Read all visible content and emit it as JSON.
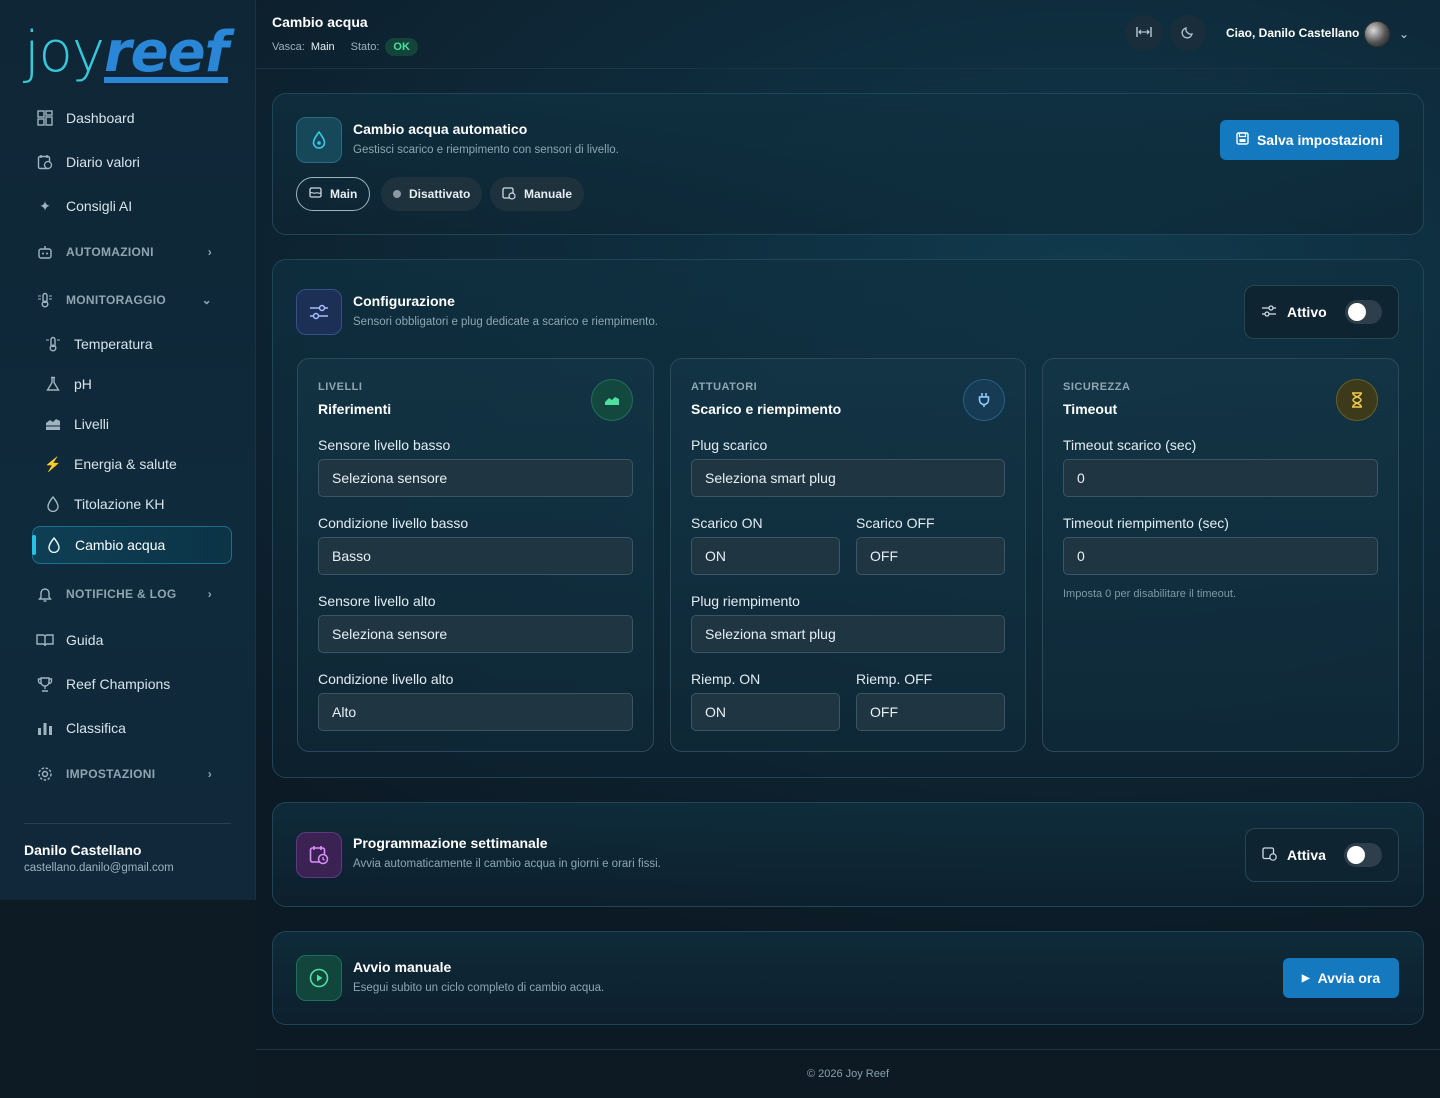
{
  "brand": {
    "joy": "joy",
    "reef": "reef"
  },
  "sidebar": {
    "items": [
      {
        "label": "Dashboard",
        "icon": "dashboard-icon"
      },
      {
        "label": "Diario valori",
        "icon": "calendar-journal-icon"
      },
      {
        "label": "Consigli AI",
        "icon": "sparkles-icon"
      }
    ],
    "automazioni": "AUTOMAZIONI",
    "monitoraggio": "MONITORAGGIO",
    "sub": [
      {
        "label": "Temperatura",
        "icon": "thermometer-icon"
      },
      {
        "label": "pH",
        "icon": "flask-icon"
      },
      {
        "label": "Livelli",
        "icon": "waves-icon"
      },
      {
        "label": "Energia & salute",
        "icon": "bolt-icon"
      },
      {
        "label": "Titolazione KH",
        "icon": "drop-icon"
      },
      {
        "label": "Cambio acqua",
        "icon": "drop-icon"
      }
    ],
    "notifiche": "NOTIFICHE & LOG",
    "bottom_items": [
      {
        "label": "Guida",
        "icon": "book-icon"
      },
      {
        "label": "Reef Champions",
        "icon": "trophy-icon"
      },
      {
        "label": "Classifica",
        "icon": "bar-chart-icon"
      }
    ],
    "impostazioni": "IMPOSTAZIONI",
    "user_name": "Danilo Castellano",
    "user_email": "castellano.danilo@gmail.com"
  },
  "topbar": {
    "title": "Cambio acqua",
    "vasca_label": "Vasca:",
    "vasca_value": "Main",
    "stato_label": "Stato:",
    "stato_value": "OK",
    "greeting": "Ciao, Danilo Castellano"
  },
  "auto_card": {
    "title": "Cambio acqua automatico",
    "subtitle": "Gestisci scarico e riempimento con sensori di livello.",
    "save_label": "Salva impostazioni",
    "chips": [
      "Main",
      "Disattivato",
      "Manuale"
    ]
  },
  "config_card": {
    "title": "Configurazione",
    "subtitle": "Sensori obbligatori e plug dedicate a scarico e riempimento.",
    "toggle_label": "Attivo",
    "levels": {
      "kicker": "LIVELLI",
      "title": "Riferimenti",
      "f1_label": "Sensore livello basso",
      "f1_value": "Seleziona sensore",
      "f2_label": "Condizione livello basso",
      "f2_value": "Basso",
      "f3_label": "Sensore livello alto",
      "f3_value": "Seleziona sensore",
      "f4_label": "Condizione livello alto",
      "f4_value": "Alto"
    },
    "actuators": {
      "kicker": "ATTUATORI",
      "title": "Scarico e riempimento",
      "plug_scarico_label": "Plug scarico",
      "plug_scarico_value": "Seleziona smart plug",
      "scarico_on_label": "Scarico ON",
      "scarico_on_value": "ON",
      "scarico_off_label": "Scarico OFF",
      "scarico_off_value": "OFF",
      "plug_riemp_label": "Plug riempimento",
      "plug_riemp_value": "Seleziona smart plug",
      "riemp_on_label": "Riemp. ON",
      "riemp_on_value": "ON",
      "riemp_off_label": "Riemp. OFF",
      "riemp_off_value": "OFF"
    },
    "safety": {
      "kicker": "SICUREZZA",
      "title": "Timeout",
      "t1_label": "Timeout scarico (sec)",
      "t1_value": "0",
      "t2_label": "Timeout riempimento (sec)",
      "t2_value": "0",
      "hint": "Imposta 0 per disabilitare il timeout."
    }
  },
  "schedule_card": {
    "title": "Programmazione settimanale",
    "subtitle": "Avvia automaticamente il cambio acqua in giorni e orari fissi.",
    "toggle_label": "Attiva"
  },
  "manual_card": {
    "title": "Avvio manuale",
    "subtitle": "Esegui subito un ciclo completo di cambio acqua.",
    "button_label": "Avvia ora"
  },
  "footer": {
    "text": "© 2026 Joy Reef"
  },
  "colors": {
    "accent": "#1579c0",
    "ok": "#4ee0a0",
    "active_nav": "#27c3e6"
  }
}
